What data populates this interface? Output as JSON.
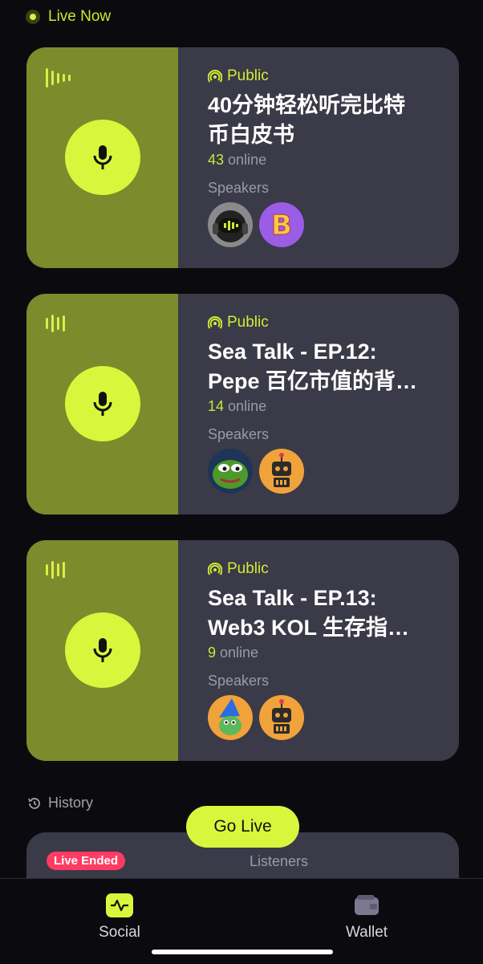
{
  "header": {
    "live_now": "Live Now"
  },
  "colors": {
    "accent": "#d8f73c",
    "card_left": "#7c8b2c",
    "card_right": "#3b3a48",
    "live_ended": "#ff3b63"
  },
  "rooms": [
    {
      "visibility": "Public",
      "title": "40分钟轻松听完比特币白皮书",
      "title_l1": "40分钟轻松听完比特",
      "title_l2": "币白皮书",
      "online_count": "43",
      "online_label": "online",
      "speakers_label": "Speakers",
      "speakers": [
        "robot-headphones-avatar",
        "bitcoin-avatar"
      ]
    },
    {
      "visibility": "Public",
      "title_l1": "Sea Talk - EP.12:",
      "title_l2": "Pepe 百亿市值的背…",
      "online_count": "14",
      "online_label": "online",
      "speakers_label": "Speakers",
      "speakers": [
        "pepe-avatar",
        "robot-avatar"
      ]
    },
    {
      "visibility": "Public",
      "title_l1": "Sea Talk - EP.13:",
      "title_l2": "Web3 KOL 生存指…",
      "online_count": "9",
      "online_label": "online",
      "speakers_label": "Speakers",
      "speakers": [
        "wizard-frog-avatar",
        "robot-avatar"
      ]
    }
  ],
  "history": {
    "label": "History",
    "card": {
      "status": "Live Ended",
      "listeners_label": "Listeners"
    }
  },
  "go_live": "Go Live",
  "tabs": [
    {
      "label": "Social",
      "icon": "activity-icon"
    },
    {
      "label": "Wallet",
      "icon": "wallet-icon"
    }
  ]
}
